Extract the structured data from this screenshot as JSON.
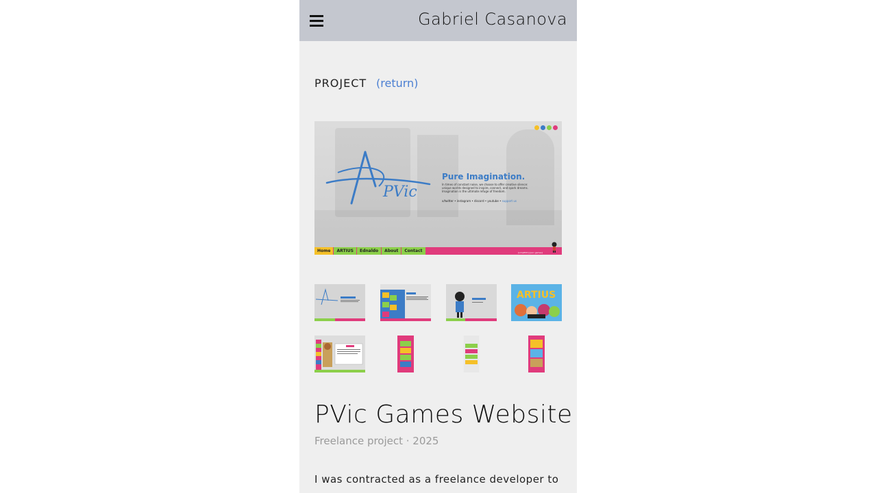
{
  "header": {
    "menu_icon": "hamburger-menu-icon",
    "site_name": "Gabriel Casanova"
  },
  "section": {
    "heading": "PROJECT",
    "return_label": "(return)"
  },
  "hero": {
    "logo_text": "PVic",
    "headline": "Pure Imagination.",
    "description": "In times of constant noise, we choose to offer creative silence: unique worlds designed to inspire, connect, and spark dreams. Imagination is the ultimate refuge of freedom.",
    "links": "x/twitter • instagram • discord • youtube •",
    "support_link": "support us",
    "nav": [
      "Home",
      "ARTIUS",
      "Ednaldo",
      "About",
      "Contact"
    ],
    "credit": "[simpEdit] [pvic.games]",
    "colors": {
      "accent_blue": "#3c7cc6",
      "nav_pink": "#e03b7c",
      "nav_green": "#8ccf4a",
      "nav_yellow": "#f5c028",
      "dots": [
        "#f5c028",
        "#3c7cc6",
        "#8ccf4a",
        "#e03b7c"
      ]
    }
  },
  "thumbnails": [
    {
      "name": "thumb-home",
      "kind": "desktop"
    },
    {
      "name": "thumb-about",
      "kind": "desktop"
    },
    {
      "name": "thumb-contact",
      "kind": "desktop"
    },
    {
      "name": "thumb-artius",
      "kind": "desktop"
    },
    {
      "name": "thumb-ednaldo",
      "kind": "desktop"
    },
    {
      "name": "thumb-mobile-1",
      "kind": "mobile"
    },
    {
      "name": "thumb-mobile-2",
      "kind": "mobile"
    },
    {
      "name": "thumb-mobile-3",
      "kind": "mobile"
    }
  ],
  "project": {
    "title": "PVic Games Website",
    "subtitle": "Freelance project · 2025",
    "description": "I was contracted as a freelance developer to"
  },
  "colors": {
    "link": "#4b7fd2",
    "topbar": "#c4c7cf",
    "page_bg": "#efefef"
  }
}
